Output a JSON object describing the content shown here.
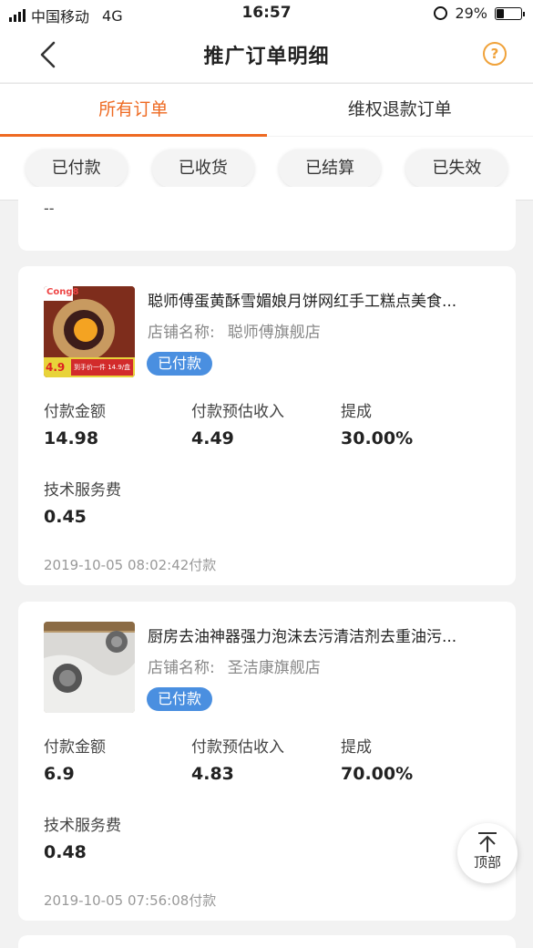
{
  "status_bar": {
    "carrier": "中国移动",
    "network": "4G",
    "time": "16:57",
    "battery": "29%"
  },
  "nav": {
    "title": "推广订单明细",
    "help_icon": "?"
  },
  "tabs": [
    {
      "label": "所有订单",
      "active": true
    },
    {
      "label": "维权退款订单",
      "active": false
    }
  ],
  "filters": [
    "已付款",
    "已收货",
    "已结算",
    "已失效"
  ],
  "partial_card": {
    "text": "--"
  },
  "orders": [
    {
      "title": "聪师傅蛋黄酥雪媚娘月饼网红手工糕点美食...",
      "shop_label": "店铺名称:",
      "shop_name": "聪师傅旗舰店",
      "status": "已付款",
      "pay_amount_label": "付款金额",
      "pay_amount": "14.98",
      "est_income_label": "付款预估收入",
      "est_income": "4.49",
      "commission_label": "提成",
      "commission": "30.00%",
      "service_fee_label": "技术服务费",
      "service_fee": "0.45",
      "time": "2019-10-05 08:02:42付款",
      "thumb_text": {
        "brand": "Cong8",
        "price": "4.9",
        "promo": "到手价一件 14.9/盒"
      }
    },
    {
      "title": "厨房去油神器强力泡沫去污清洁剂去重油污...",
      "shop_label": "店铺名称:",
      "shop_name": "圣洁康旗舰店",
      "status": "已付款",
      "pay_amount_label": "付款金额",
      "pay_amount": "6.9",
      "est_income_label": "付款预估收入",
      "est_income": "4.83",
      "commission_label": "提成",
      "commission": "70.00%",
      "service_fee_label": "技术服务费",
      "service_fee": "0.48",
      "time": "2019-10-05 07:56:08付款"
    }
  ],
  "to_top": {
    "label": "顶部"
  },
  "colors": {
    "accent": "#ee6a22",
    "badge": "#4a8fe0",
    "help": "#f0a23a"
  }
}
